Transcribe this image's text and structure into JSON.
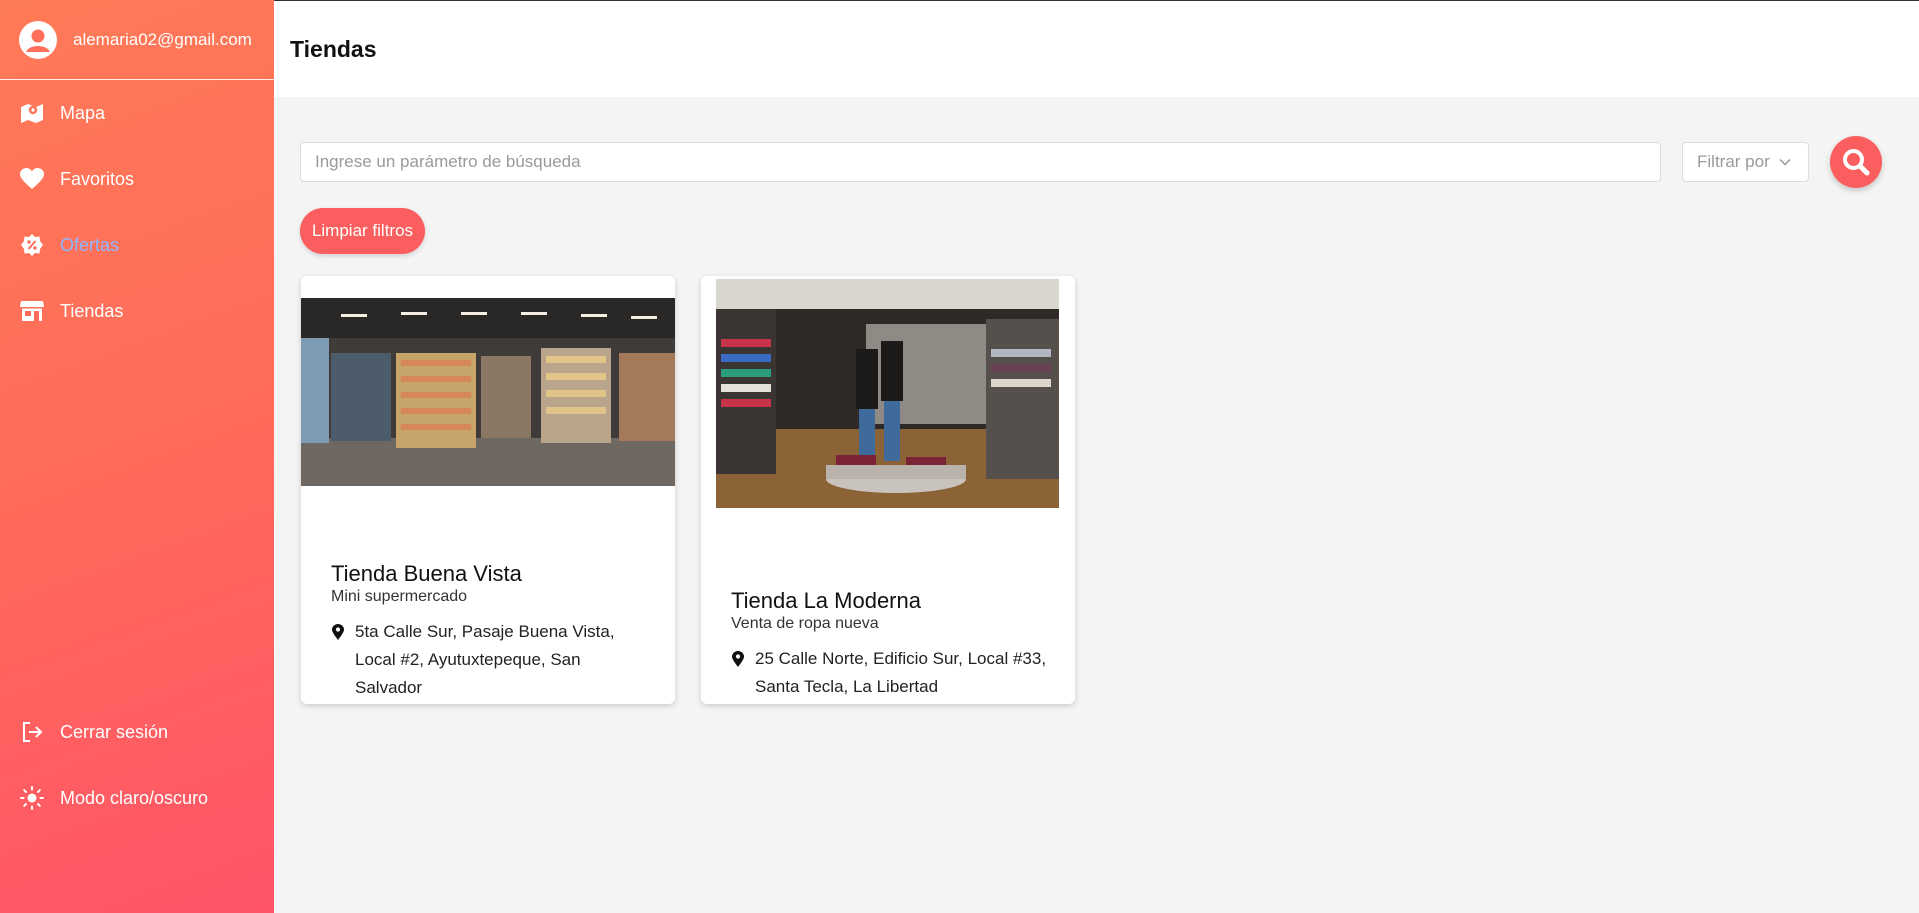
{
  "sidebar": {
    "user_email": "alemaria02@gmail.com",
    "nav": [
      {
        "label": "Mapa",
        "icon": "map-icon"
      },
      {
        "label": "Favoritos",
        "icon": "heart-icon"
      },
      {
        "label": "Ofertas",
        "icon": "discount-badge-icon",
        "active": true
      },
      {
        "label": "Tiendas",
        "icon": "store-icon"
      }
    ],
    "bottom": [
      {
        "label": "Cerrar sesión",
        "icon": "logout-icon"
      },
      {
        "label": "Modo claro/oscuro",
        "icon": "sun-icon"
      }
    ]
  },
  "header": {
    "title": "Tiendas"
  },
  "search": {
    "placeholder": "Ingrese un parámetro de búsqueda",
    "filter_label": "Filtrar por",
    "clear_label": "Limpiar filtros"
  },
  "stores": [
    {
      "name": "Tienda Buena Vista",
      "category": "Mini supermercado",
      "address": "5ta Calle Sur, Pasaje Buena Vista, Local #2, Ayutuxtepeque, San Salvador"
    },
    {
      "name": "Tienda La Moderna",
      "category": "Venta de ropa nueva",
      "address": "25 Calle Norte, Edificio Sur, Local #33, Santa Tecla, La Libertad"
    }
  ],
  "colors": {
    "sidebar_start": "#ff7a57",
    "sidebar_end": "#ff5468",
    "accent": "#fb5e5e",
    "active_nav": "#8fb6ff",
    "page_bg": "#f4f4f4"
  }
}
